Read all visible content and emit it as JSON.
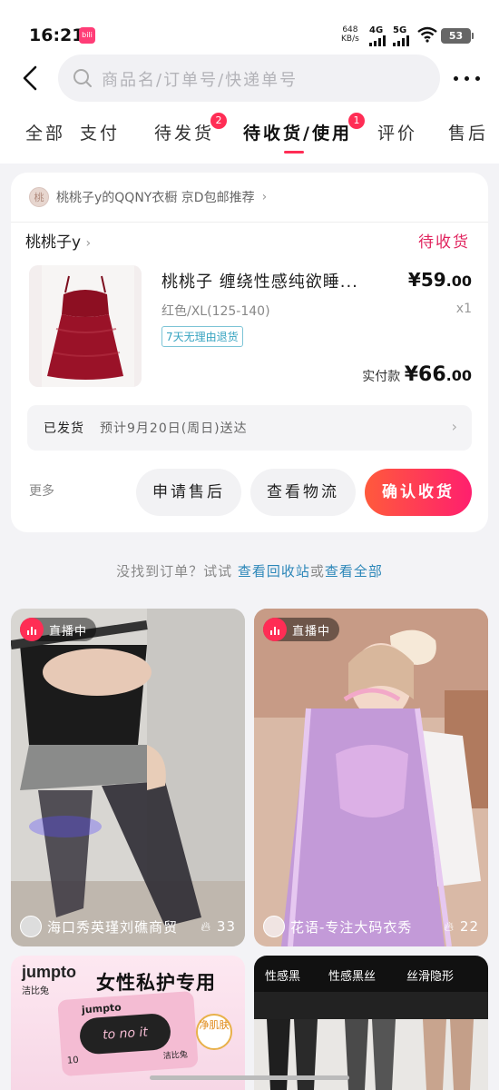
{
  "status_bar": {
    "time": "16:21",
    "app_badge": "bilibili",
    "net_speed_value": "648",
    "net_speed_unit": "KB/s",
    "signal_1": "4G",
    "signal_2": "5G",
    "battery": "53"
  },
  "search": {
    "placeholder": "商品名/订单号/快递单号"
  },
  "tabs": [
    {
      "label": "全部"
    },
    {
      "label": "待支付",
      "visible_text": "支付"
    },
    {
      "label": "待发货",
      "badge": "2"
    },
    {
      "label": "待收货/使用",
      "badge": "1",
      "active": true
    },
    {
      "label": "评价"
    },
    {
      "label": "售后"
    }
  ],
  "order": {
    "shop_promo": "桃桃子y的QQNY衣橱 京D包邮推荐",
    "seller": "桃桃子y",
    "status": "待收货",
    "product_title": "桃桃子 缠绕性感纯欲睡...",
    "price_main": "¥59",
    "price_decimal": ".00",
    "spec": "红色/XL(125-140)",
    "quantity": "x1",
    "return_tag": "7天无理由退货",
    "paid_label": "实付款",
    "paid_main": "¥66",
    "paid_decimal": ".00",
    "shipping_status": "已发货",
    "shipping_eta": "预计9月20日(周日)送达",
    "more_label": "更多",
    "btn_after_sale": "申请售后",
    "btn_logistics": "查看物流",
    "btn_confirm": "确认收货",
    "accent": "#ff2d55"
  },
  "hint": {
    "prefix": "没找到订单？试试",
    "link1": "查看回收站",
    "mid": "或",
    "link2": "查看全部"
  },
  "feed": [
    {
      "live_label": "直播中",
      "name": "海口秀英瑾刘礁商贸",
      "count": "33"
    },
    {
      "live_label": "直播中",
      "name": "花语-专注大码衣秀",
      "count": "22"
    },
    {
      "brand": "jumpto",
      "brand_cn": "洁比兔",
      "headline": "女性私护专用",
      "pack_brand": "jumpto",
      "pack_script": "to no it",
      "pack_count": "10",
      "pack_name": "洁比兔",
      "badge": "净肌肤"
    },
    {
      "labels": [
        "性感黑",
        "性感黑丝",
        "丝滑隐形"
      ]
    }
  ]
}
